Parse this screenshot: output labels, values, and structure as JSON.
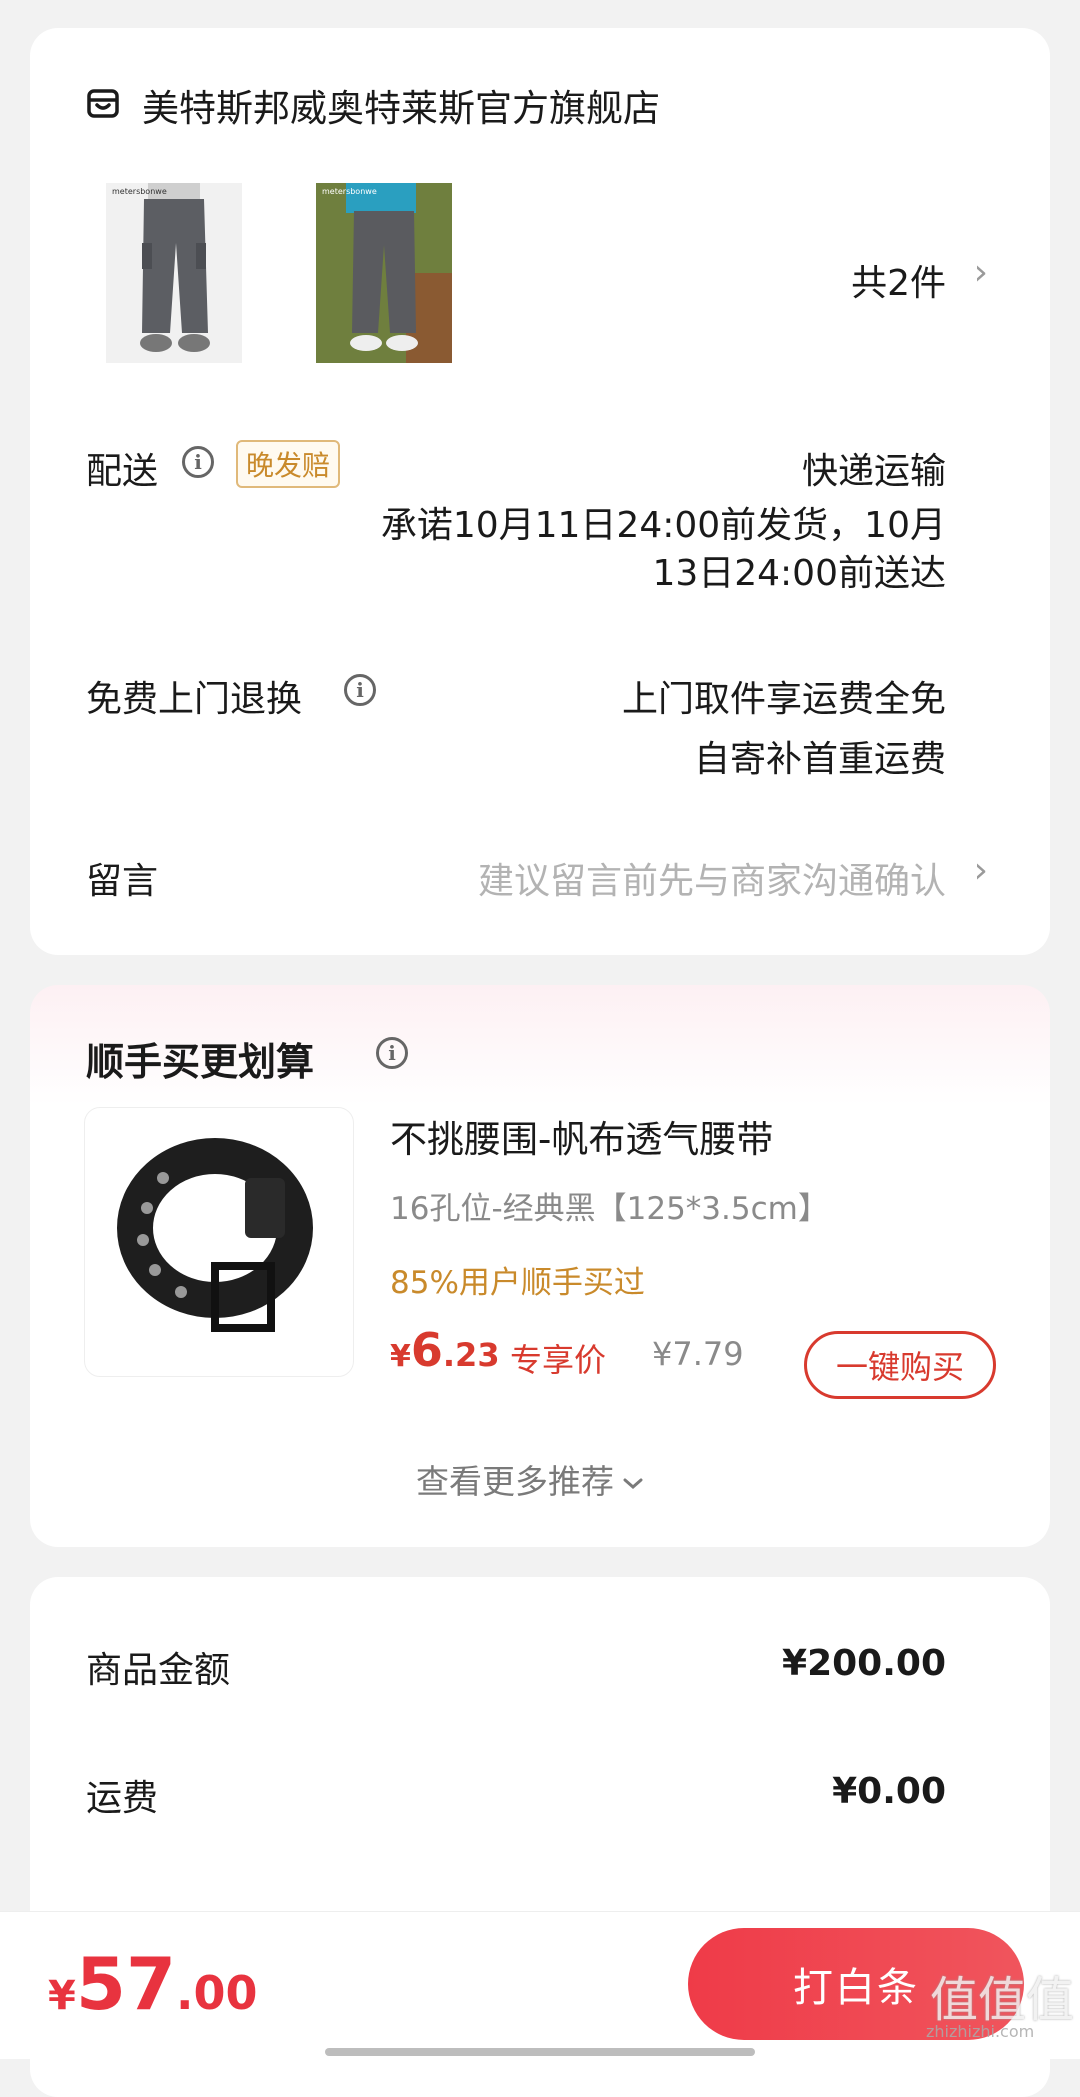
{
  "shop": {
    "name": "美特斯邦威奥特莱斯官方旗舰店",
    "item_count": "共2件",
    "thumb_brand": "metersbonwe"
  },
  "delivery": {
    "label": "配送",
    "badge": "晚发赔",
    "method": "快递运输",
    "promise_line1": "承诺10月11日24:00前发货，10月",
    "promise_line2": "13日24:00前送达"
  },
  "returns": {
    "label": "免费上门退换",
    "line1": "上门取件享运费全免",
    "line2": "自寄补首重运费"
  },
  "message": {
    "label": "留言",
    "placeholder": "建议留言前先与商家沟通确认"
  },
  "upsell": {
    "title": "顺手买更划算",
    "product_title": "不挑腰围-帆布透气腰带",
    "spec": "16孔位-经典黑【125*3.5cm】",
    "social_proof": "85%用户顺手买过",
    "price_symbol": "¥",
    "price_int": "6",
    "price_dec": ".23",
    "price_tag": "专享价",
    "original_price": "¥7.79",
    "buy_label": "一键购买",
    "more_label": "查看更多推荐"
  },
  "summary": {
    "goods_label": "商品金额",
    "goods_value": "¥200.00",
    "shipping_label": "运费",
    "shipping_value": "¥0.00"
  },
  "bottom": {
    "total_symbol": "¥",
    "total_int": "57",
    "total_dec": ".00",
    "pay_label": "打白条",
    "watermark": "值",
    "watermark_url": "zhizhizhi.com"
  },
  "colors": {
    "accent_red": "#e8333f",
    "price_red": "#d83a2e",
    "gold": "#c98a2b"
  }
}
